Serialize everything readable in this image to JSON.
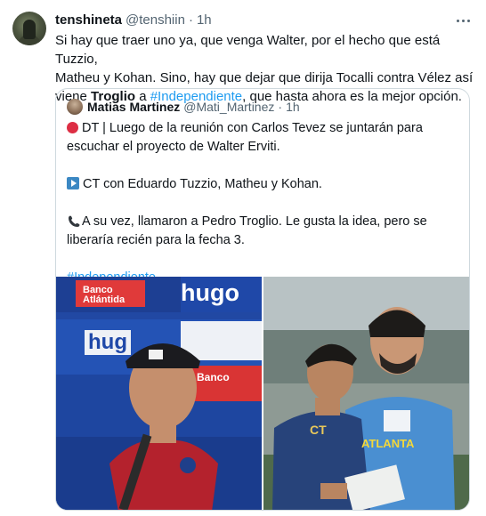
{
  "tweet": {
    "author_name": "tenshineta",
    "author_handle": "@tenshiin",
    "separator": "·",
    "time": "1h",
    "text_line1": "Si hay que traer uno ya, que venga Walter, por el hecho que está Tuzzio,",
    "text_line2": "Matheu y Kohan. Sino, hay que dejar que dirija Tocalli contra Vélez así",
    "text_line3_pre": "viene ",
    "text_line3_bold": "Troglio",
    "text_line3_mid": " a ",
    "text_line3_link": "#Independiente",
    "text_line3_post": ", que hasta ahora es la mejor opción."
  },
  "quote": {
    "author_name": "Matias Martinez",
    "author_handle": "@Mati_Martinez",
    "separator": "·",
    "time": "1h",
    "p1": "DT | Luego de la reunión con Carlos Tevez se juntarán para escuchar el proyecto de Walter Erviti.",
    "p2": "CT con Eduardo Tuzzio, Matheu y Kohan.",
    "p3": "A su vez, llamaron a Pedro Troglio. Le gusta la idea, pero se liberaría recién para la fecha 3.",
    "p4": "#Independiente"
  },
  "media": {
    "left_banner_1": "Banco Atlántida",
    "left_banner_2": "hugo",
    "left_banner_3": "hug",
    "left_banner_4": "Banco",
    "right_shirt_1": "CT",
    "right_shirt_2": "ATLANTA"
  },
  "colors": {
    "accent": "#1d9bf0",
    "muted": "#536471",
    "border": "#cfd9de"
  }
}
